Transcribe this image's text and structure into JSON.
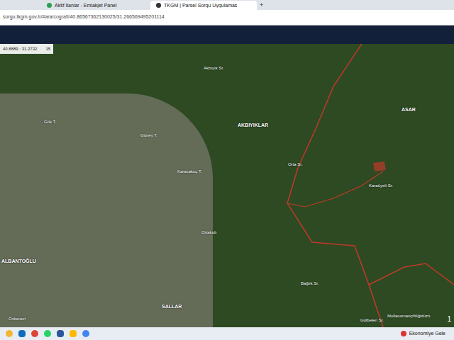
{
  "browser": {
    "tabs": [
      {
        "label": "Aktif İlanlar - Emlakjet Panel",
        "selected": false
      },
      {
        "label": "TKGM | Parsel Sorgu Uygulamas",
        "selected": true
      }
    ],
    "new_tab": "+",
    "address": "sorgu.tkgm.gov.tr/#ara/cografi/40.86567362130025/31.266569495201114"
  },
  "map_toolbar": {
    "coordinates": "40.8889 : 31.2732",
    "zoom": "15"
  },
  "map": {
    "labels": [
      {
        "text": "Akbıyık Sr.",
        "kind": "area"
      },
      {
        "text": "Gök T.",
        "kind": "area"
      },
      {
        "text": "AKBIYIKLAR",
        "kind": "village"
      },
      {
        "text": "Güney T.",
        "kind": "area"
      },
      {
        "text": "Karacakoç T.",
        "kind": "area"
      },
      {
        "text": "ASAR",
        "kind": "village"
      },
      {
        "text": "Orta Sr.",
        "kind": "area"
      },
      {
        "text": "Karaüyeli Sr.",
        "kind": "area"
      },
      {
        "text": "Ortakıdı",
        "kind": "area"
      },
      {
        "text": "ALBANTOĞLU",
        "kind": "village"
      },
      {
        "text": "SALLAR",
        "kind": "village"
      },
      {
        "text": "Bağlık Sr.",
        "kind": "area"
      },
      {
        "text": "Gölbelen Sr.",
        "kind": "area"
      },
      {
        "text": "Mollaosmançiftliğidüzü",
        "kind": "area"
      },
      {
        "text": "Özkeneri",
        "kind": "area"
      }
    ],
    "corner_text": "1"
  },
  "taskbar": {
    "news": "Ekonomiye Gele"
  }
}
